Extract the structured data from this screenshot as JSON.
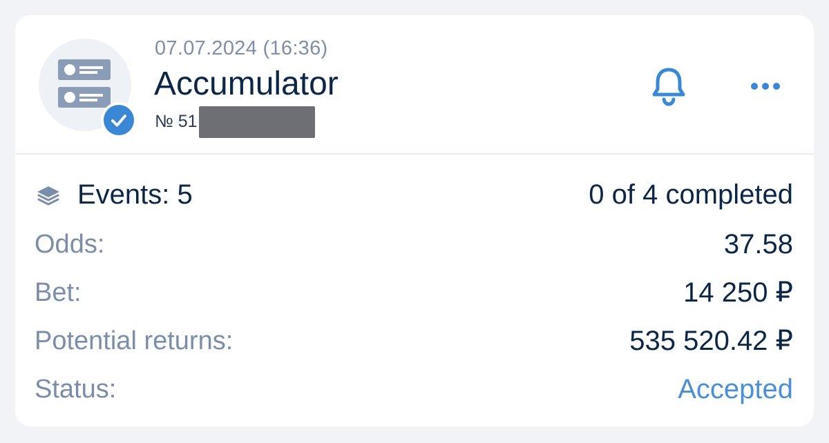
{
  "header": {
    "date": "07.07.2024 (16:36)",
    "bet_type": "Accumulator",
    "bet_number_prefix": "№ 51",
    "avatar_icon": "bet-slip-icon",
    "badge_icon": "check-icon",
    "notification_icon": "bell-icon",
    "menu_icon": "more-dots-icon"
  },
  "summary": {
    "events_label": "Events: 5",
    "events_icon": "layers-icon",
    "progress_text": "0 of 4 completed"
  },
  "details": [
    {
      "label": "Odds:",
      "value": "37.58"
    },
    {
      "label": "Bet:",
      "value": "14 250 ₽"
    },
    {
      "label": "Potential returns:",
      "value": "535 520.42 ₽"
    },
    {
      "label": "Status:",
      "value": "Accepted"
    }
  ],
  "colors": {
    "accent": "#3a87d6",
    "primary_text": "#0c2647",
    "secondary_text": "#7b8ea9",
    "status_accepted": "#4a8fd8"
  }
}
